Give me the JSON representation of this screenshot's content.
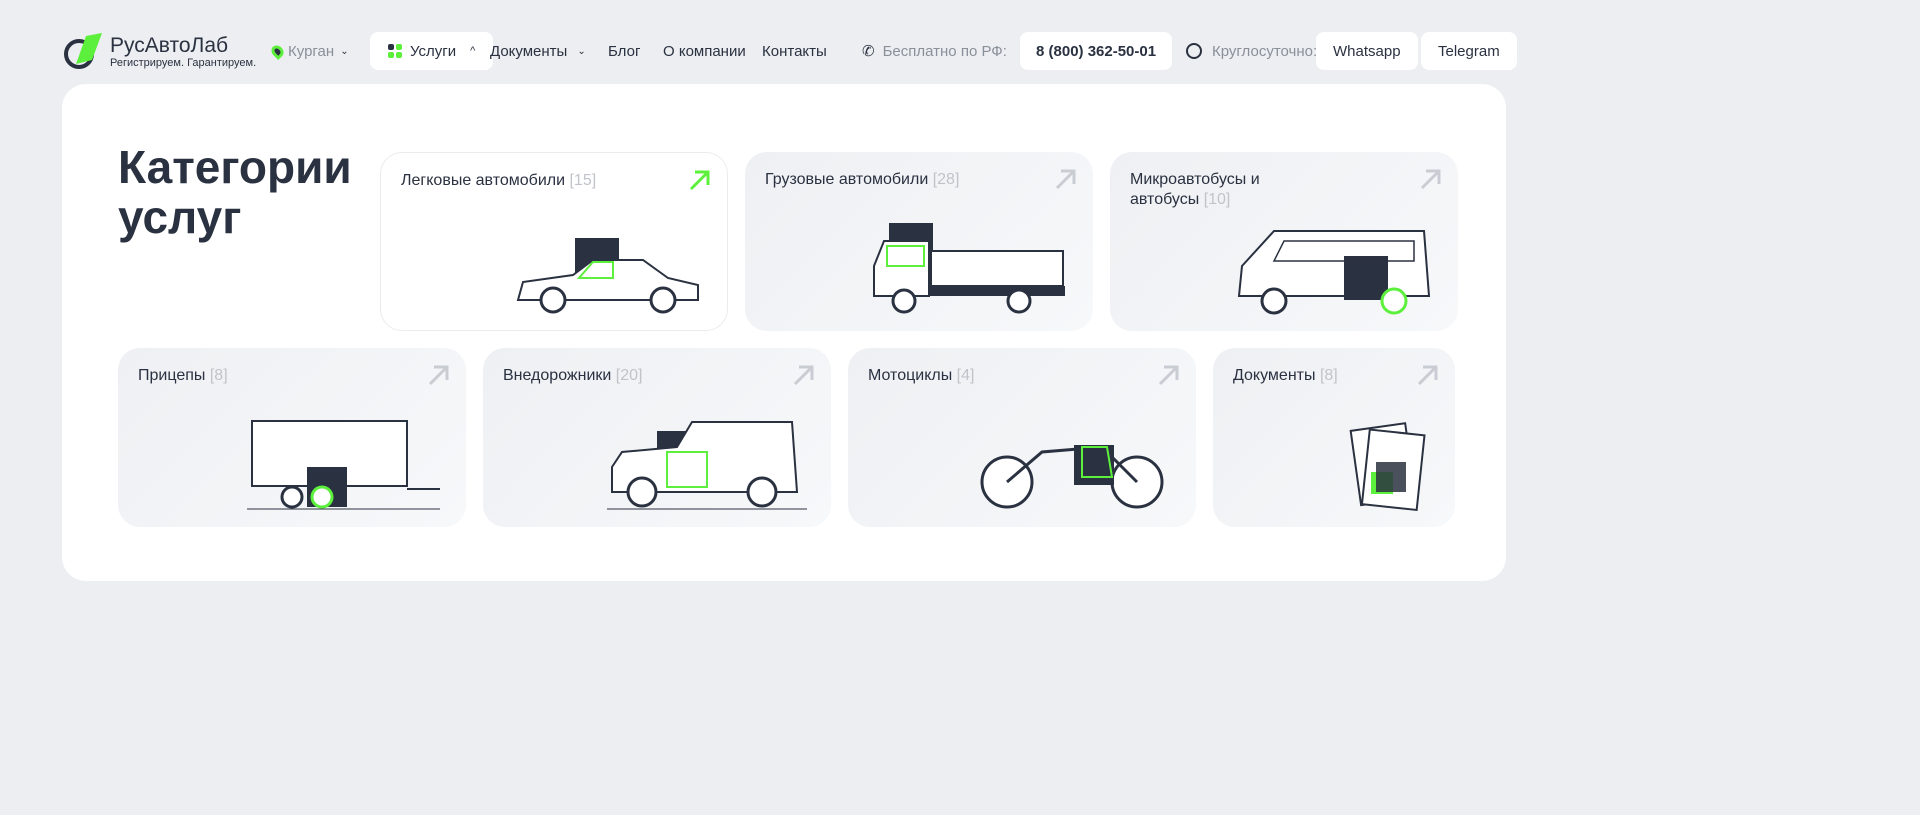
{
  "header": {
    "logo_name": "РусАвтоЛаб",
    "logo_tagline": "Регистрируем. Гарантируем.",
    "city": "Курган",
    "nav": [
      "Услуги",
      "Документы",
      "Блог",
      "О компании",
      "Контакты"
    ],
    "free_label": "Бесплатно по РФ:",
    "phone": "8 (800) 362-50-01",
    "hours_label": "Круглосуточно:",
    "whatsapp": "Whatsapp",
    "telegram": "Telegram"
  },
  "main": {
    "title": "Категории услуг",
    "categories": [
      {
        "label": "Легковые автомобили",
        "count": "[15]"
      },
      {
        "label": "Грузовые автомобили",
        "count": "[28]"
      },
      {
        "label": "Микроавтобусы и автобусы",
        "count": "[10]"
      },
      {
        "label": "Прицепы",
        "count": "[8]"
      },
      {
        "label": "Внедорожники",
        "count": "[20]"
      },
      {
        "label": "Мотоциклы",
        "count": "[4]"
      },
      {
        "label": "Документы",
        "count": "[8]"
      }
    ]
  },
  "colors": {
    "accent": "#5cf03c",
    "dark": "#2a3140"
  }
}
